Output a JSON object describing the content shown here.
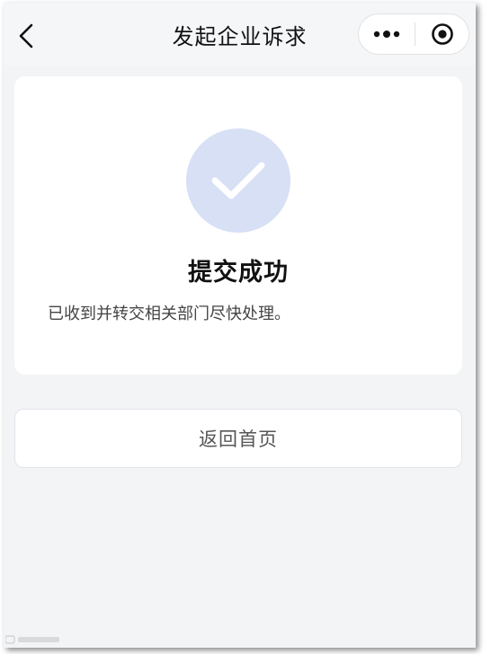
{
  "navbar": {
    "title": "发起企业诉求"
  },
  "icons": {
    "back": "chevron-left-icon",
    "more": "more-dots-icon",
    "close": "record-circle-icon",
    "success": "checkmark-icon"
  },
  "result": {
    "title": "提交成功",
    "message": "已收到并转交相关部门尽快处理。"
  },
  "actions": {
    "home_label": "返回首页"
  },
  "colors": {
    "page_background": "#f3f4f6",
    "check_circle": "#d7e0f5",
    "check_mark": "#ffffff"
  }
}
